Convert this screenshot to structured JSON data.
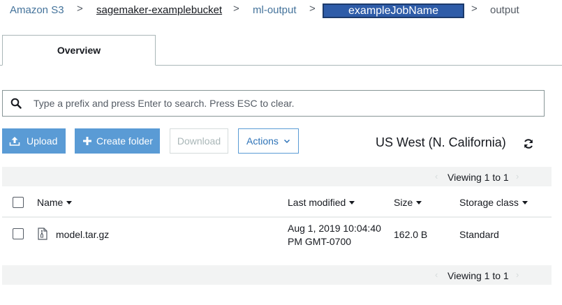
{
  "breadcrumb": {
    "items": [
      "Amazon S3",
      "sagemaker-examplebucket",
      "ml-output",
      "exampleJobName",
      "output"
    ],
    "separator": ">"
  },
  "tabs": [
    {
      "label": "Overview",
      "active": true
    }
  ],
  "search": {
    "value": "",
    "placeholder": "Type a prefix and press Enter to search. Press ESC to clear."
  },
  "toolbar": {
    "upload_label": "Upload",
    "create_folder_label": "Create folder",
    "download_label": "Download",
    "actions_label": "Actions",
    "region": "US West (N. California)"
  },
  "pagination": {
    "top_text": "Viewing 1 to 1",
    "bottom_text": "Viewing 1 to 1"
  },
  "table": {
    "columns": [
      "Name",
      "Last modified",
      "Size",
      "Storage class"
    ],
    "rows": [
      {
        "name": "model.tar.gz",
        "last_modified_line1": "Aug 1, 2019 10:04:40",
        "last_modified_line2": "PM GMT-0700",
        "size": "162.0 B",
        "storage_class": "Standard"
      }
    ]
  },
  "colors": {
    "primary_button": "#5a9bd5",
    "link": "#44739b",
    "highlight": "#2e5ca8"
  },
  "icons": [
    "search-icon",
    "upload-icon",
    "plus-icon",
    "chevron-down-icon",
    "refresh-icon",
    "file-archive-icon",
    "sort-caret-icon"
  ]
}
